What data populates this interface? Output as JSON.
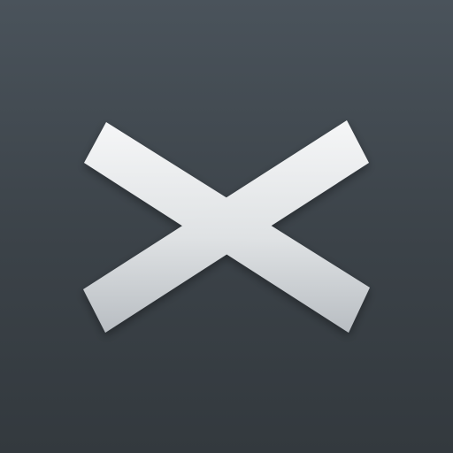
{
  "app_icon": {
    "icon_name": "x-cross-icon",
    "colors": {
      "background_top": "#4a535b",
      "background_bottom": "#33393e",
      "glyph_light": "#f4f5f6",
      "glyph_dark": "#b9bec3"
    }
  }
}
